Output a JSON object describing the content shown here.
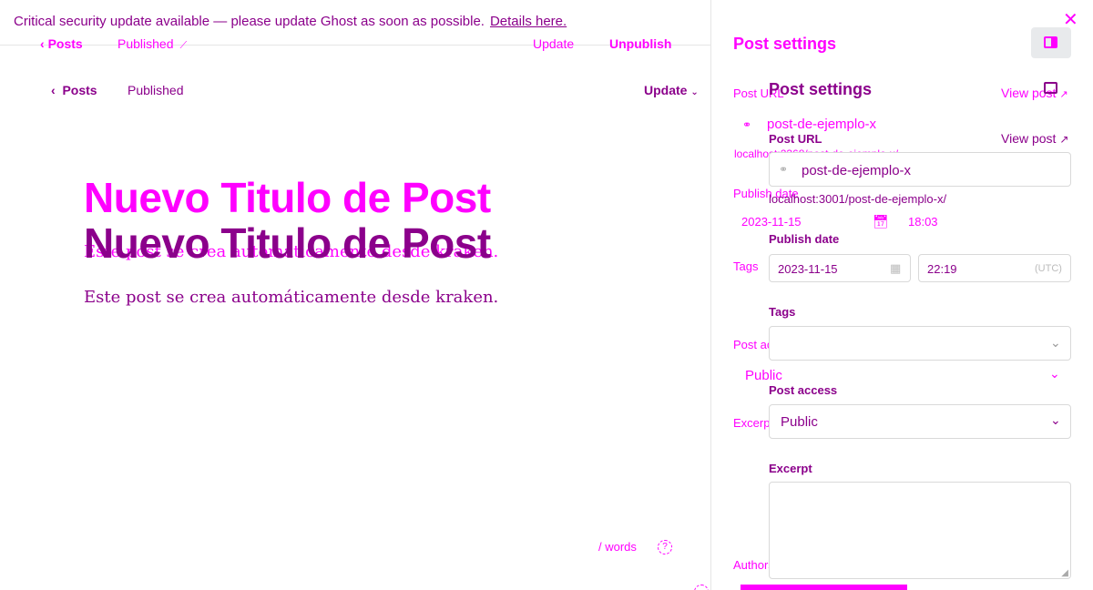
{
  "banner": {
    "text": "Critical security update available — please update Ghost as soon as possible.",
    "link": "Details here."
  },
  "ghost_header": {
    "back": "Posts",
    "status": "Published",
    "update": "Update",
    "unpublish": "Unpublish"
  },
  "editor_header": {
    "back": "Posts",
    "status": "Published",
    "update": "Update"
  },
  "editor": {
    "title": "Nuevo Titulo de Post",
    "body": "Este post se crea automáticamente desde kraken.",
    "ghost_title": "Nuevo Titulo de Post",
    "ghost_body": "Este post se crea automáticamente desde kraken.",
    "word_count": "/ words",
    "help": "?"
  },
  "settings_ghost": {
    "title": "Post settings",
    "post_url_label": "Post URL",
    "view_post": "View post",
    "slug": "post-de-ejemplo-x",
    "url_hint": "localhost:2368/post-de-ejemplo-x/",
    "publish_date_label": "Publish date",
    "date": "2023-11-15",
    "time": "18:03",
    "tags_label": "Tags",
    "post_access_label": "Post access",
    "access_value": "Public",
    "excerpt_label": "Excerpt",
    "authors_label": "Authors"
  },
  "settings": {
    "title": "Post settings",
    "post_url_label": "Post URL",
    "view_post": "View post",
    "slug": "post-de-ejemplo-x",
    "url_hint": "localhost:3001/post-de-ejemplo-x/",
    "publish_date_label": "Publish date",
    "date": "2023-11-15",
    "time": "22:19",
    "timezone": "(UTC)",
    "tags_label": "Tags",
    "post_access_label": "Post access",
    "access_value": "Public",
    "excerpt_label": "Excerpt",
    "excerpt_value": ""
  },
  "icons": {
    "close": "close-icon",
    "sidebar_toggle": "sidebar-toggle-icon",
    "link": "link-icon",
    "calendar": "calendar-icon",
    "external": "external-link-icon",
    "chevron": "chevron-down-icon"
  },
  "colors": {
    "ghost": "#ff00ff",
    "real": "#8b008b",
    "divider": "#e6e6e6"
  }
}
